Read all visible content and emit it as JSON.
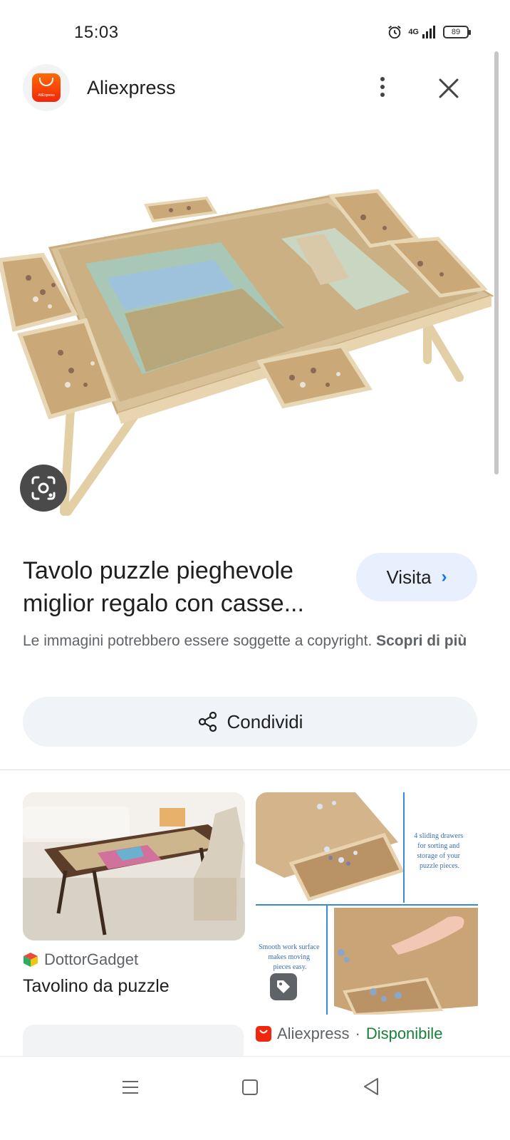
{
  "status_bar": {
    "time": "15:03",
    "network": "4G",
    "battery": "89",
    "icons": [
      "alarm-icon",
      "signal-icon",
      "battery-icon"
    ]
  },
  "header": {
    "app_name": "Aliexpress",
    "logo_text": "AliExpress",
    "icons": [
      "more-vert-icon",
      "close-icon"
    ]
  },
  "product": {
    "title": "Tavolo puzzle pieghevole miglior regalo con casse...",
    "visit_label": "Visita",
    "copyright_text": "Le immagini potrebbero essere soggette a copyright.",
    "copyright_link": "Scopri di più",
    "share_label": "Condividi",
    "image_icon": "lens-icon"
  },
  "results": [
    {
      "source": "DottorGadget",
      "title": "Tavolino da puzzle"
    },
    {
      "source": "Aliexpress",
      "availability": "Disponibile",
      "separator": " · ",
      "image_texts": [
        "4 sliding drawers for sorting and storage of your puzzle pieces.",
        "Smooth work surface makes moving pieces easy."
      ]
    }
  ],
  "colors": {
    "accent": "#1a73e8",
    "visit_bg": "#e8f0fe",
    "share_bg": "#f0f4f9",
    "available": "#188038",
    "aliexpress_red": "#f0270c"
  },
  "nav": {
    "icons": [
      "menu-icon",
      "home-icon",
      "back-icon"
    ]
  }
}
